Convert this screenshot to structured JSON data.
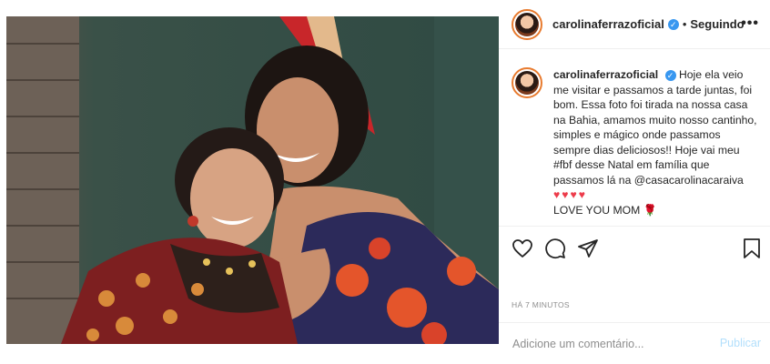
{
  "post": {
    "username": "carolinaferrazoficial",
    "verified_mark": "✓",
    "dot": "•",
    "follow_status": "Seguindo",
    "more_label": "•••"
  },
  "caption": {
    "username": "carolinaferrazoficial",
    "text": "Hoje ela veio me visitar e passamos a tarde juntas, foi bom. Essa foto foi tirada na nossa casa na Bahia, amamos muito nosso cantinho, simples e mágico onde passamos sempre dias deliciosos!! Hoje vai meu #fbf desse Natal em família que passamos lá na @casacarolinacaraiva",
    "hearts": "♥♥♥♥",
    "closing": "LOVE YOU MOM",
    "rose": "🌹"
  },
  "actions": {
    "like": "heart-icon",
    "comment": "comment-icon",
    "share": "share-icon",
    "save": "bookmark-icon"
  },
  "timestamp": "HÁ 7 MINUTOS",
  "comment_box": {
    "placeholder": "Adicione um comentário...",
    "publish_label": "Publicar"
  },
  "colors": {
    "verified": "#3897f0",
    "hearts": "#ed3b4a",
    "publish_disabled": "#b2dffc"
  }
}
